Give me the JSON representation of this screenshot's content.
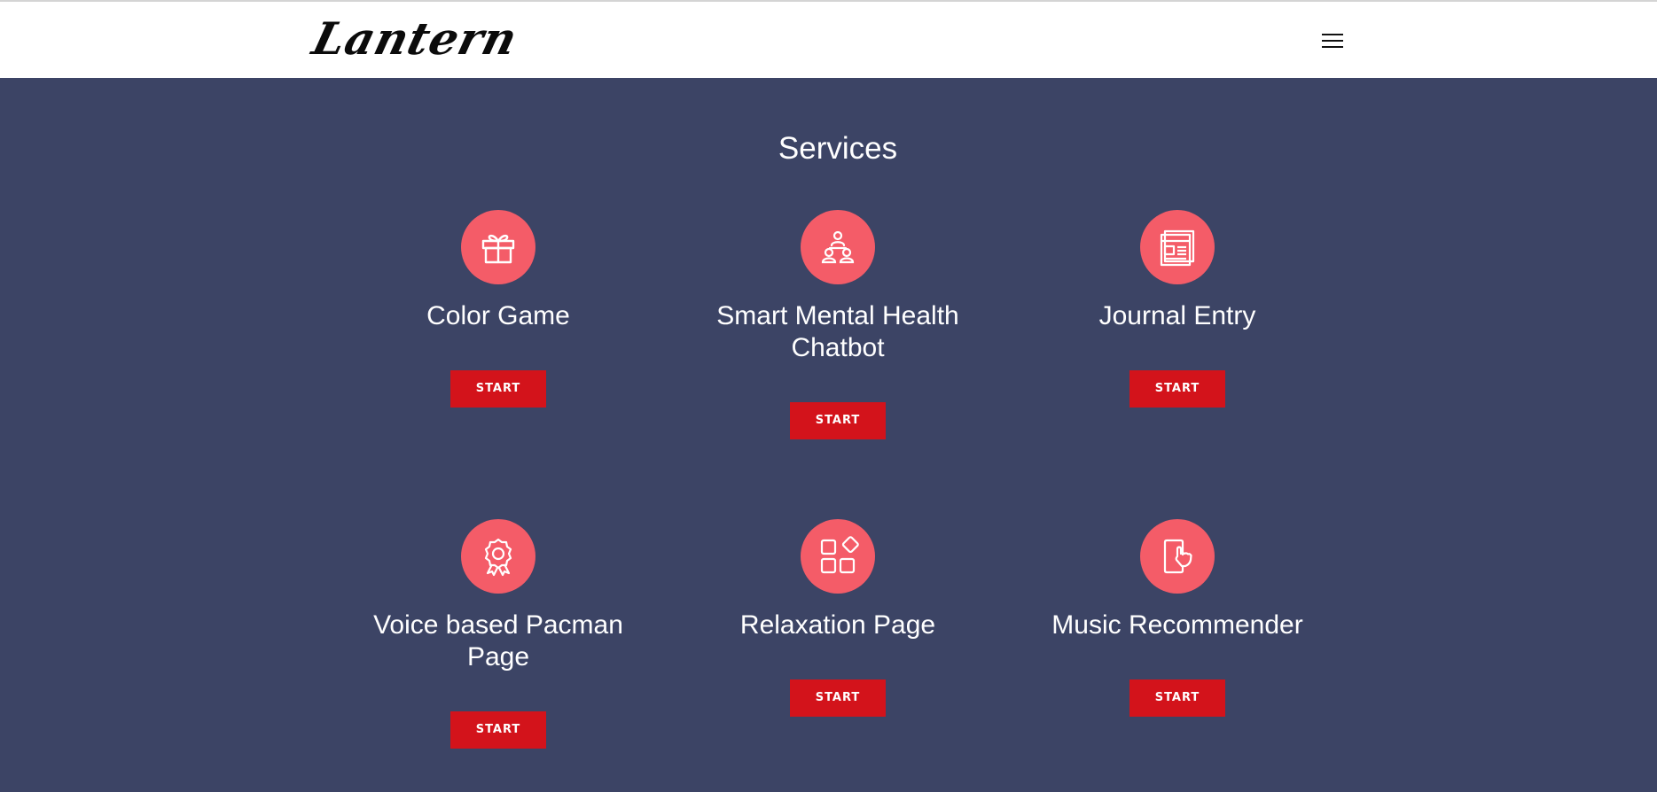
{
  "header": {
    "logo_text": "Lantern",
    "menu_icon": "hamburger-menu-icon"
  },
  "services": {
    "title": "Services",
    "items": [
      {
        "name": "Color Game",
        "icon": "gift-icon",
        "button_label": "START"
      },
      {
        "name": "Smart Mental Health Chatbot",
        "icon": "user-group-icon",
        "button_label": "START"
      },
      {
        "name": "Journal Entry",
        "icon": "newspaper-icon",
        "button_label": "START"
      },
      {
        "name": "Voice based Pacman Page",
        "icon": "award-ribbon-icon",
        "button_label": "START"
      },
      {
        "name": "Relaxation Page",
        "icon": "apps-grid-icon",
        "button_label": "START"
      },
      {
        "name": "Music Recommender",
        "icon": "tablet-touch-icon",
        "button_label": "START"
      }
    ]
  },
  "colors": {
    "background": "#3c4465",
    "header_background": "#ffffff",
    "icon_circle": "#f45c68",
    "button": "#d3131b",
    "text": "#ffffff"
  }
}
